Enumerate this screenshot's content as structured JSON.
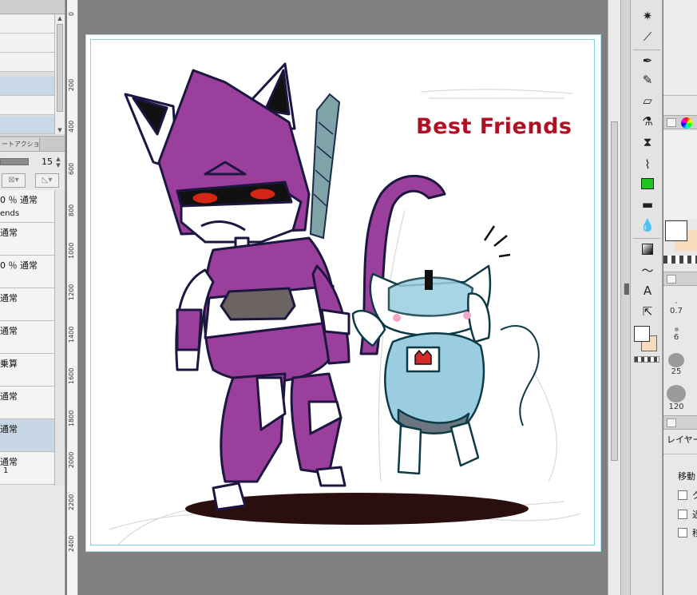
{
  "layer_panel": {
    "tab_label": "ートアクション",
    "opacity_value": "15",
    "layers": [
      {
        "mode": "0 ％ 通常",
        "name": "ends"
      },
      {
        "mode": "通常",
        "name": ""
      },
      {
        "mode": "0 ％ 通常",
        "name": ""
      },
      {
        "mode": "通常",
        "name": ""
      },
      {
        "mode": "通常",
        "name": ""
      },
      {
        "mode": "乗算",
        "name": ""
      },
      {
        "mode": "通常",
        "name": ""
      },
      {
        "mode": "通常",
        "name": ""
      },
      {
        "mode": "通常",
        "name": "1"
      }
    ]
  },
  "ruler": {
    "labels": [
      "0",
      "200",
      "400",
      "600",
      "800",
      "1000",
      "1200",
      "1400",
      "1600",
      "1800",
      "2000",
      "2200",
      "2400"
    ]
  },
  "canvas": {
    "title": "Best Friends",
    "title_color": "#b01024",
    "purple": "#9b3f9c",
    "light_blue": "#9acde0",
    "shadow": "#2b0e0e"
  },
  "tools": {
    "items": [
      "sparkle-icon",
      "eyedropper-icon",
      "pen-icon",
      "pencil-icon",
      "eraser-icon",
      "fill-bucket-icon",
      "blend-icon",
      "brush-icon",
      "fill-tool-icon",
      "line-icon",
      "drops-icon",
      "gradient-icon",
      "curve-icon",
      "text-icon",
      "select-arrow-icon"
    ]
  },
  "right_panel": {
    "brush_sizes": [
      "0.7",
      "6",
      "25",
      "120"
    ],
    "layer_label": "レイヤー",
    "move_label": "移動",
    "checkbox_labels": [
      "ク",
      "近",
      "移"
    ]
  }
}
